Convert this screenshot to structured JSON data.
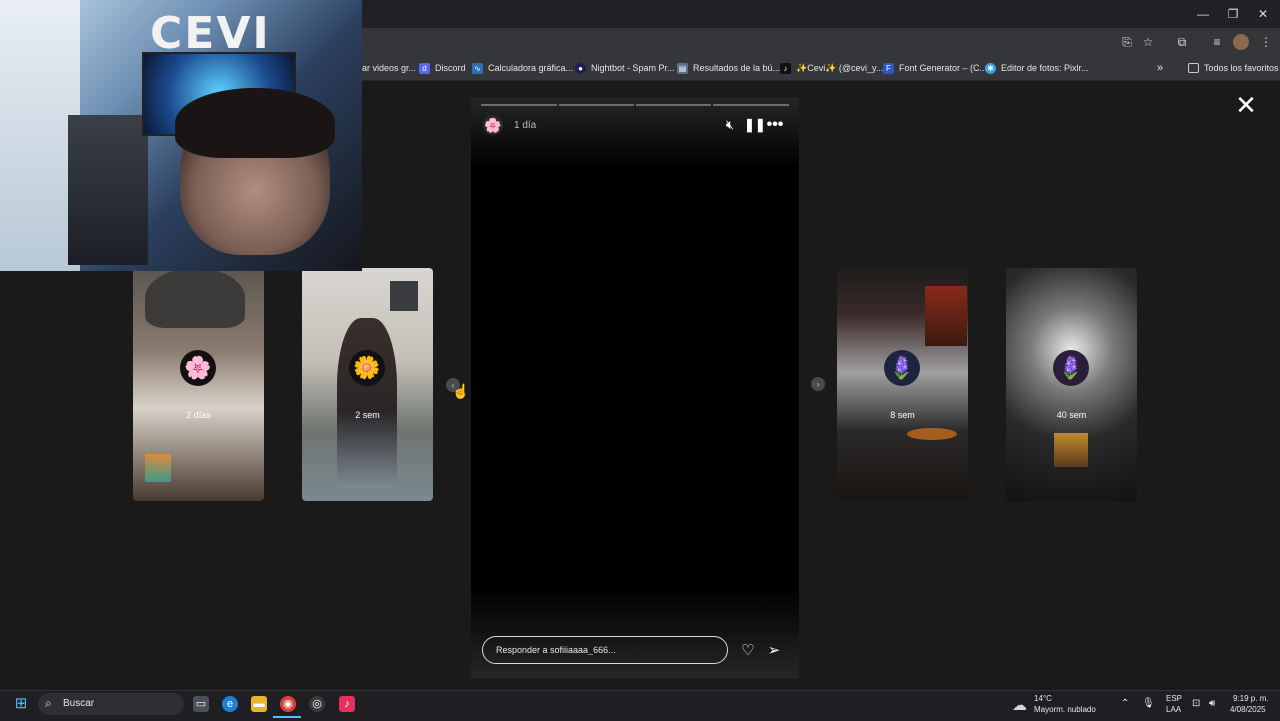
{
  "browser": {
    "window_controls": [
      "—",
      "❐",
      "✕"
    ],
    "bookmarks": [
      {
        "label": "ar videos gr...",
        "icon": "bookmark-generic"
      },
      {
        "label": "Discord",
        "icon": "discord-icon",
        "color": "#5865f2"
      },
      {
        "label": "Calculadora gráfica...",
        "icon": "desmos-icon",
        "color": "#2d70b3"
      },
      {
        "label": "Nightbot - Spam Pr...",
        "icon": "nightbot-icon",
        "color": "#1e1e50"
      },
      {
        "label": "Resultados de la bú...",
        "icon": "page-icon",
        "color": "#5b6f8c"
      },
      {
        "label": "✨Cevi✨ (@cevi_y...",
        "icon": "tiktok-icon",
        "color": "#111111"
      },
      {
        "label": "Font Generator – (C...",
        "icon": "font-generator-icon",
        "color": "#2d55c8"
      },
      {
        "label": "Editor de fotos: Pixlr...",
        "icon": "pixlr-icon",
        "color": "#3aa0e8"
      }
    ],
    "bookmarks_overflow": "»",
    "all_favorites": "Todos los favoritos"
  },
  "webcam": {
    "sign_text": "CEVI"
  },
  "story": {
    "time": "1 día",
    "reply_placeholder": "Responder a sofiiiaaaa_666...",
    "close": "✕"
  },
  "side_stories": [
    {
      "age": "2 días",
      "avatar": "🌸"
    },
    {
      "age": "2 sem",
      "avatar": "🌼"
    },
    {
      "age": "8 sem",
      "avatar": "🪻"
    },
    {
      "age": "40 sem",
      "avatar": "🪻"
    }
  ],
  "taskbar": {
    "search_label": "Buscar",
    "weather_temp": "14°C",
    "weather_desc": "Mayorm. nublado",
    "lang_top": "ESP",
    "lang_bottom": "LAA",
    "time": "9:19 p. m.",
    "date": "4/08/2025"
  }
}
